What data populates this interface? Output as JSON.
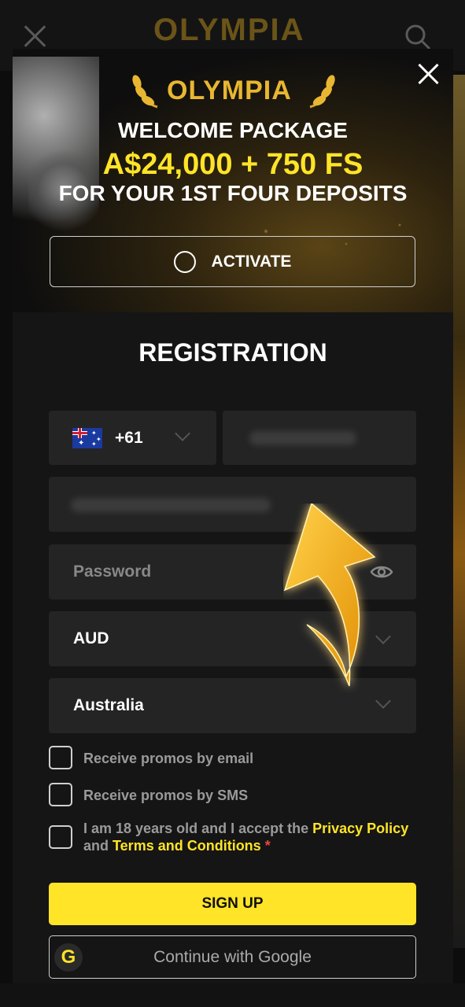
{
  "background": {
    "logo": "OLYMPIA"
  },
  "banner": {
    "logo": "OLYMPIA",
    "line1": "WELCOME PACKAGE",
    "line2": "A$24,000 + 750 FS",
    "line3": "FOR YOUR 1ST FOUR DEPOSITS",
    "activate_label": "ACTIVATE"
  },
  "registration": {
    "title": "REGISTRATION",
    "phone_code": "+61",
    "password_placeholder": "Password",
    "currency": "AUD",
    "country": "Australia",
    "checkbox_email": "Receive promos by email",
    "checkbox_sms": "Receive promos by SMS",
    "terms_prefix": "I am 18 years old and I accept the ",
    "privacy_link": "Privacy Policy",
    "terms_and": "and ",
    "terms_link": "Terms and Conditions",
    "required_mark": " *",
    "signup_label": "SIGN UP",
    "google_label": "Continue with Google",
    "google_badge": "G"
  },
  "colors": {
    "accent_yellow": "#ffe427",
    "gold": "#e8b631",
    "field_bg": "#242424",
    "modal_bg": "#151515"
  },
  "icons": [
    "close-icon",
    "search-icon",
    "laurel-icon",
    "flag-au-icon",
    "chevron-down-icon",
    "eye-icon",
    "google-icon",
    "arrow-annotation"
  ]
}
